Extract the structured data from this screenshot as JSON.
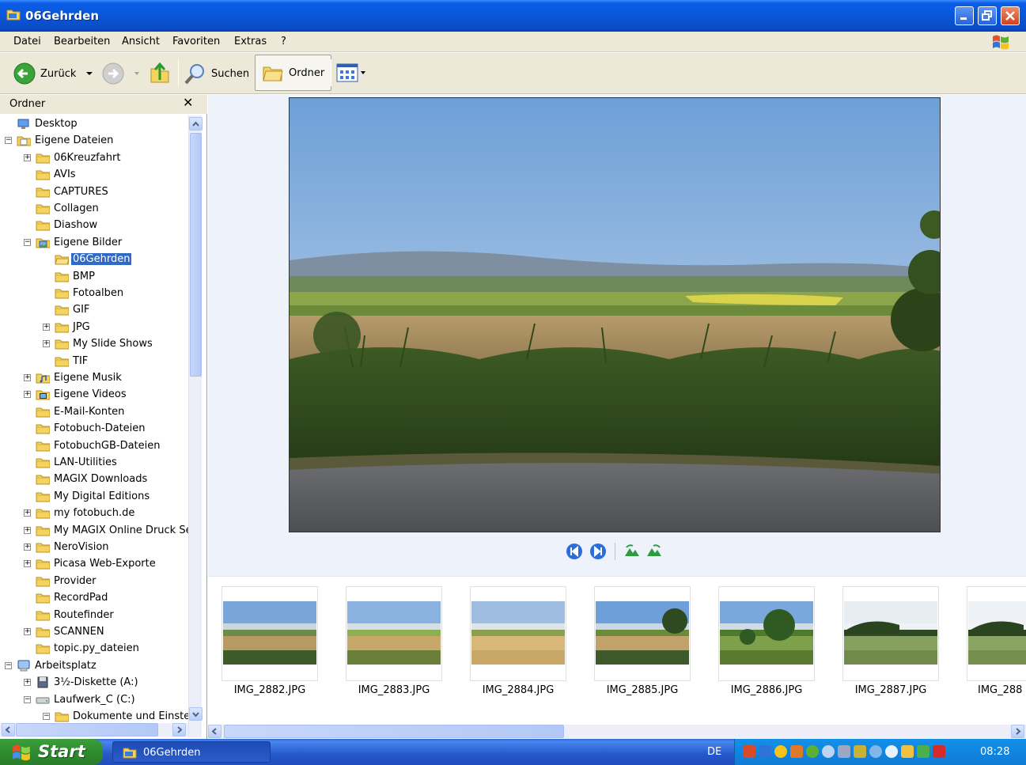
{
  "window": {
    "title": "06Gehrden"
  },
  "menu": [
    "Datei",
    "Bearbeiten",
    "Ansicht",
    "Favoriten",
    "Extras",
    "?"
  ],
  "toolbar": {
    "back_label": "Zurück",
    "search_label": "Suchen",
    "folders_label": "Ordner"
  },
  "folder_pane": {
    "title": "Ordner",
    "tree": [
      {
        "label": "Desktop",
        "depth": 0,
        "expander": "none",
        "icon": "desktop-icon"
      },
      {
        "label": "Eigene Dateien",
        "depth": 0,
        "expander": "minus",
        "icon": "my-documents-icon"
      },
      {
        "label": "06Kreuzfahrt",
        "depth": 1,
        "expander": "plus",
        "icon": "folder-icon"
      },
      {
        "label": "AVIs",
        "depth": 1,
        "expander": "none",
        "icon": "folder-icon"
      },
      {
        "label": "CAPTURES",
        "depth": 1,
        "expander": "none",
        "icon": "folder-icon"
      },
      {
        "label": "Collagen",
        "depth": 1,
        "expander": "none",
        "icon": "folder-icon"
      },
      {
        "label": "Diashow",
        "depth": 1,
        "expander": "none",
        "icon": "folder-icon"
      },
      {
        "label": "Eigene Bilder",
        "depth": 1,
        "expander": "minus",
        "icon": "my-pictures-icon"
      },
      {
        "label": "06Gehrden",
        "depth": 2,
        "expander": "none",
        "icon": "open-folder-icon",
        "selected": true
      },
      {
        "label": "BMP",
        "depth": 2,
        "expander": "none",
        "icon": "folder-icon"
      },
      {
        "label": "Fotoalben",
        "depth": 2,
        "expander": "none",
        "icon": "folder-icon"
      },
      {
        "label": "GIF",
        "depth": 2,
        "expander": "none",
        "icon": "folder-icon"
      },
      {
        "label": "JPG",
        "depth": 2,
        "expander": "plus",
        "icon": "folder-icon"
      },
      {
        "label": "My Slide Shows",
        "depth": 2,
        "expander": "plus",
        "icon": "folder-icon"
      },
      {
        "label": "TIF",
        "depth": 2,
        "expander": "none",
        "icon": "folder-icon"
      },
      {
        "label": "Eigene Musik",
        "depth": 1,
        "expander": "plus",
        "icon": "my-music-icon"
      },
      {
        "label": "Eigene Videos",
        "depth": 1,
        "expander": "plus",
        "icon": "my-videos-icon"
      },
      {
        "label": "E-Mail-Konten",
        "depth": 1,
        "expander": "none",
        "icon": "folder-icon"
      },
      {
        "label": "Fotobuch-Dateien",
        "depth": 1,
        "expander": "none",
        "icon": "folder-icon"
      },
      {
        "label": "FotobuchGB-Dateien",
        "depth": 1,
        "expander": "none",
        "icon": "folder-icon"
      },
      {
        "label": "LAN-Utilities",
        "depth": 1,
        "expander": "none",
        "icon": "folder-icon"
      },
      {
        "label": "MAGIX Downloads",
        "depth": 1,
        "expander": "none",
        "icon": "folder-icon"
      },
      {
        "label": "My Digital Editions",
        "depth": 1,
        "expander": "none",
        "icon": "folder-icon"
      },
      {
        "label": "my fotobuch.de",
        "depth": 1,
        "expander": "plus",
        "icon": "folder-icon"
      },
      {
        "label": "My MAGIX Online Druck Ser",
        "depth": 1,
        "expander": "plus",
        "icon": "folder-icon"
      },
      {
        "label": "NeroVision",
        "depth": 1,
        "expander": "plus",
        "icon": "folder-icon"
      },
      {
        "label": "Picasa Web-Exporte",
        "depth": 1,
        "expander": "plus",
        "icon": "folder-icon"
      },
      {
        "label": "Provider",
        "depth": 1,
        "expander": "none",
        "icon": "folder-icon"
      },
      {
        "label": "RecordPad",
        "depth": 1,
        "expander": "none",
        "icon": "folder-icon"
      },
      {
        "label": "Routefinder",
        "depth": 1,
        "expander": "none",
        "icon": "folder-icon"
      },
      {
        "label": "SCANNEN",
        "depth": 1,
        "expander": "plus",
        "icon": "folder-icon"
      },
      {
        "label": "topic.py_dateien",
        "depth": 1,
        "expander": "none",
        "icon": "folder-icon"
      },
      {
        "label": "Arbeitsplatz",
        "depth": 0,
        "expander": "minus",
        "icon": "my-computer-icon"
      },
      {
        "label": "3½-Diskette (A:)",
        "depth": 1,
        "expander": "plus",
        "icon": "floppy-icon"
      },
      {
        "label": "Laufwerk_C (C:)",
        "depth": 1,
        "expander": "minus",
        "icon": "drive-icon"
      },
      {
        "label": "Dokumente und Einstellu",
        "depth": 2,
        "expander": "minus",
        "icon": "folder-icon"
      }
    ]
  },
  "thumbnails": [
    {
      "label": "IMG_2882.JPG",
      "variant": "field-wide"
    },
    {
      "label": "IMG_2883.JPG",
      "variant": "field-bright"
    },
    {
      "label": "IMG_2884.JPG",
      "variant": "field-stubble"
    },
    {
      "label": "IMG_2885.JPG",
      "variant": "field-tree"
    },
    {
      "label": "IMG_2886.JPG",
      "variant": "trees-path"
    },
    {
      "label": "IMG_2887.JPG",
      "variant": "meadow-forest"
    },
    {
      "label": "IMG_288",
      "variant": "meadow-forest-2"
    }
  ],
  "taskbar": {
    "start_label": "Start",
    "task_label": "06Gehrden",
    "language": "DE",
    "clock": "08:28"
  },
  "colors": {
    "titlebar": "#0a56d8",
    "selection": "#316ac5",
    "start_green": "#2f8d2f",
    "tray_blue": "#1290e9"
  }
}
